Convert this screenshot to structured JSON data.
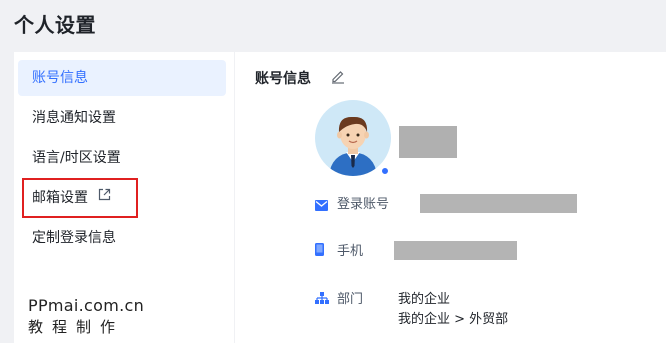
{
  "page": {
    "title": "个人设置"
  },
  "sidebar": {
    "items": [
      {
        "label": "账号信息",
        "active": true
      },
      {
        "label": "消息通知设置",
        "active": false
      },
      {
        "label": "语言/时区设置",
        "active": false
      },
      {
        "label": "邮箱设置",
        "active": false,
        "external": true,
        "highlighted": true
      },
      {
        "label": "定制登录信息",
        "active": false
      }
    ]
  },
  "watermark": {
    "url": "PPmai.com.cn",
    "subtitle": "教程制作"
  },
  "account": {
    "section_title": "账号信息",
    "fields": [
      {
        "icon": "mail-icon",
        "label": "登录账号"
      },
      {
        "icon": "phone-icon",
        "label": "手机"
      },
      {
        "icon": "org-icon",
        "label": "部门",
        "values": [
          "我的企业",
          "我的企业 > 外贸部"
        ]
      }
    ]
  },
  "colors": {
    "accent": "#3370ff",
    "highlight_box": "#e02020",
    "background": "#f0f1f4"
  }
}
